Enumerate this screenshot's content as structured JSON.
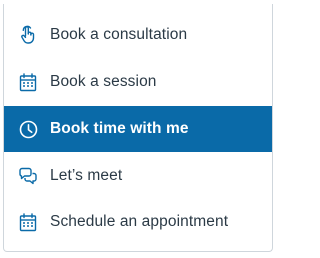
{
  "theme": {
    "accent": "#0a6aa8",
    "icon_color": "#0a6aa8",
    "text_color": "#2b3a46"
  },
  "menu": {
    "items": [
      {
        "label": "Book a consultation",
        "icon": "hand-touch-icon",
        "selected": false
      },
      {
        "label": "Book a session",
        "icon": "calendar-icon",
        "selected": false
      },
      {
        "label": "Book time with me",
        "icon": "clock-icon",
        "selected": true
      },
      {
        "label": "Let’s meet",
        "icon": "chat-bubbles-icon",
        "selected": false
      },
      {
        "label": "Schedule an appointment",
        "icon": "calendar-icon",
        "selected": false
      }
    ]
  }
}
